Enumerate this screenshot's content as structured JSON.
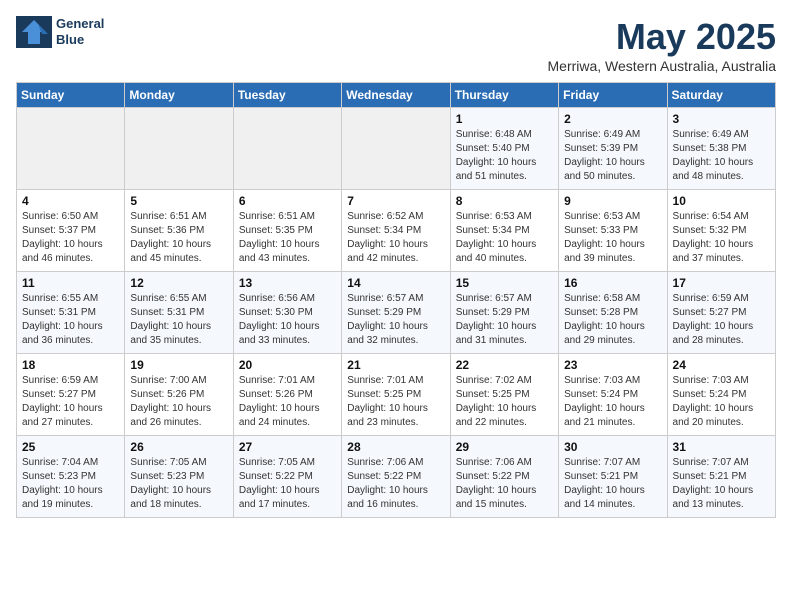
{
  "logo": {
    "line1": "General",
    "line2": "Blue"
  },
  "title": "May 2025",
  "subtitle": "Merriwa, Western Australia, Australia",
  "days_of_week": [
    "Sunday",
    "Monday",
    "Tuesday",
    "Wednesday",
    "Thursday",
    "Friday",
    "Saturday"
  ],
  "weeks": [
    [
      {
        "day": "",
        "detail": ""
      },
      {
        "day": "",
        "detail": ""
      },
      {
        "day": "",
        "detail": ""
      },
      {
        "day": "",
        "detail": ""
      },
      {
        "day": "1",
        "detail": "Sunrise: 6:48 AM\nSunset: 5:40 PM\nDaylight: 10 hours\nand 51 minutes."
      },
      {
        "day": "2",
        "detail": "Sunrise: 6:49 AM\nSunset: 5:39 PM\nDaylight: 10 hours\nand 50 minutes."
      },
      {
        "day": "3",
        "detail": "Sunrise: 6:49 AM\nSunset: 5:38 PM\nDaylight: 10 hours\nand 48 minutes."
      }
    ],
    [
      {
        "day": "4",
        "detail": "Sunrise: 6:50 AM\nSunset: 5:37 PM\nDaylight: 10 hours\nand 46 minutes."
      },
      {
        "day": "5",
        "detail": "Sunrise: 6:51 AM\nSunset: 5:36 PM\nDaylight: 10 hours\nand 45 minutes."
      },
      {
        "day": "6",
        "detail": "Sunrise: 6:51 AM\nSunset: 5:35 PM\nDaylight: 10 hours\nand 43 minutes."
      },
      {
        "day": "7",
        "detail": "Sunrise: 6:52 AM\nSunset: 5:34 PM\nDaylight: 10 hours\nand 42 minutes."
      },
      {
        "day": "8",
        "detail": "Sunrise: 6:53 AM\nSunset: 5:34 PM\nDaylight: 10 hours\nand 40 minutes."
      },
      {
        "day": "9",
        "detail": "Sunrise: 6:53 AM\nSunset: 5:33 PM\nDaylight: 10 hours\nand 39 minutes."
      },
      {
        "day": "10",
        "detail": "Sunrise: 6:54 AM\nSunset: 5:32 PM\nDaylight: 10 hours\nand 37 minutes."
      }
    ],
    [
      {
        "day": "11",
        "detail": "Sunrise: 6:55 AM\nSunset: 5:31 PM\nDaylight: 10 hours\nand 36 minutes."
      },
      {
        "day": "12",
        "detail": "Sunrise: 6:55 AM\nSunset: 5:31 PM\nDaylight: 10 hours\nand 35 minutes."
      },
      {
        "day": "13",
        "detail": "Sunrise: 6:56 AM\nSunset: 5:30 PM\nDaylight: 10 hours\nand 33 minutes."
      },
      {
        "day": "14",
        "detail": "Sunrise: 6:57 AM\nSunset: 5:29 PM\nDaylight: 10 hours\nand 32 minutes."
      },
      {
        "day": "15",
        "detail": "Sunrise: 6:57 AM\nSunset: 5:29 PM\nDaylight: 10 hours\nand 31 minutes."
      },
      {
        "day": "16",
        "detail": "Sunrise: 6:58 AM\nSunset: 5:28 PM\nDaylight: 10 hours\nand 29 minutes."
      },
      {
        "day": "17",
        "detail": "Sunrise: 6:59 AM\nSunset: 5:27 PM\nDaylight: 10 hours\nand 28 minutes."
      }
    ],
    [
      {
        "day": "18",
        "detail": "Sunrise: 6:59 AM\nSunset: 5:27 PM\nDaylight: 10 hours\nand 27 minutes."
      },
      {
        "day": "19",
        "detail": "Sunrise: 7:00 AM\nSunset: 5:26 PM\nDaylight: 10 hours\nand 26 minutes."
      },
      {
        "day": "20",
        "detail": "Sunrise: 7:01 AM\nSunset: 5:26 PM\nDaylight: 10 hours\nand 24 minutes."
      },
      {
        "day": "21",
        "detail": "Sunrise: 7:01 AM\nSunset: 5:25 PM\nDaylight: 10 hours\nand 23 minutes."
      },
      {
        "day": "22",
        "detail": "Sunrise: 7:02 AM\nSunset: 5:25 PM\nDaylight: 10 hours\nand 22 minutes."
      },
      {
        "day": "23",
        "detail": "Sunrise: 7:03 AM\nSunset: 5:24 PM\nDaylight: 10 hours\nand 21 minutes."
      },
      {
        "day": "24",
        "detail": "Sunrise: 7:03 AM\nSunset: 5:24 PM\nDaylight: 10 hours\nand 20 minutes."
      }
    ],
    [
      {
        "day": "25",
        "detail": "Sunrise: 7:04 AM\nSunset: 5:23 PM\nDaylight: 10 hours\nand 19 minutes."
      },
      {
        "day": "26",
        "detail": "Sunrise: 7:05 AM\nSunset: 5:23 PM\nDaylight: 10 hours\nand 18 minutes."
      },
      {
        "day": "27",
        "detail": "Sunrise: 7:05 AM\nSunset: 5:22 PM\nDaylight: 10 hours\nand 17 minutes."
      },
      {
        "day": "28",
        "detail": "Sunrise: 7:06 AM\nSunset: 5:22 PM\nDaylight: 10 hours\nand 16 minutes."
      },
      {
        "day": "29",
        "detail": "Sunrise: 7:06 AM\nSunset: 5:22 PM\nDaylight: 10 hours\nand 15 minutes."
      },
      {
        "day": "30",
        "detail": "Sunrise: 7:07 AM\nSunset: 5:21 PM\nDaylight: 10 hours\nand 14 minutes."
      },
      {
        "day": "31",
        "detail": "Sunrise: 7:07 AM\nSunset: 5:21 PM\nDaylight: 10 hours\nand 13 minutes."
      }
    ]
  ]
}
